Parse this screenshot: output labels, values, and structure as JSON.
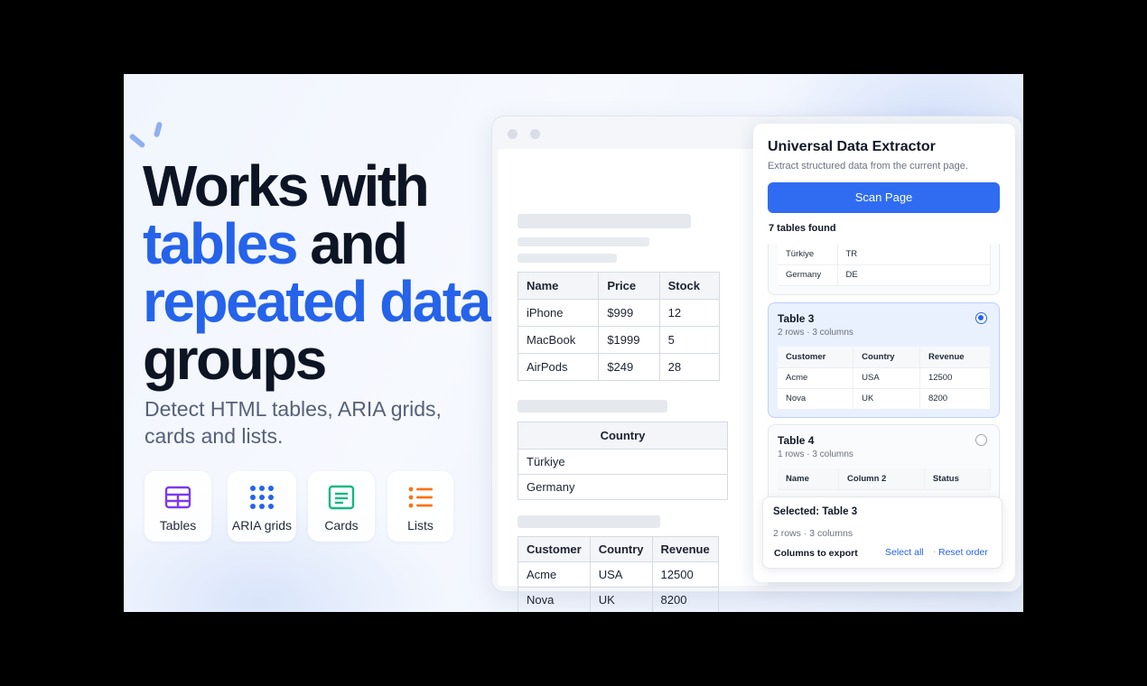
{
  "hero": {
    "line1": "Works with",
    "line2_blue": "tables",
    "line2_rest": " and",
    "line3_blue": "repeated data",
    "line4": "groups",
    "subhead": "Detect HTML tables, ARIA grids, cards and lists."
  },
  "features": [
    {
      "label": "Tables",
      "icon": "table-icon",
      "color": "#7c3aed"
    },
    {
      "label": "ARIA grids",
      "icon": "grid-dots-icon",
      "color": "#2563eb"
    },
    {
      "label": "Cards",
      "icon": "card-icon",
      "color": "#10b981"
    },
    {
      "label": "Lists",
      "icon": "list-icon",
      "color": "#f97316"
    }
  ],
  "webpage": {
    "table1": {
      "headers": [
        "Name",
        "Price",
        "Stock"
      ],
      "rows": [
        [
          "iPhone",
          "$999",
          "12"
        ],
        [
          "MacBook",
          "$1999",
          "5"
        ],
        [
          "AirPods",
          "$249",
          "28"
        ]
      ]
    },
    "table2": {
      "headers": [
        "Country"
      ],
      "rows": [
        [
          "Türkiye"
        ],
        [
          "Germany"
        ]
      ]
    },
    "table3": {
      "headers": [
        "Customer",
        "Country",
        "Revenue"
      ],
      "rows": [
        [
          "Acme",
          "USA",
          "12500"
        ],
        [
          "Nova",
          "UK",
          "8200"
        ]
      ]
    }
  },
  "panel": {
    "title": "Universal Data Extractor",
    "subtitle": "Extract structured data from the current page.",
    "scan_label": "Scan Page",
    "found_text": "7 tables found",
    "partial_card": {
      "rows": [
        [
          "Türkiye",
          "TR"
        ],
        [
          "Germany",
          "DE"
        ]
      ]
    },
    "table3_card": {
      "title": "Table 3",
      "meta": "2 rows · 3 columns",
      "selected": true,
      "headers": [
        "Customer",
        "Country",
        "Revenue"
      ],
      "rows": [
        [
          "Acme",
          "USA",
          "12500"
        ],
        [
          "Nova",
          "UK",
          "8200"
        ]
      ]
    },
    "table4_card": {
      "title": "Table 4",
      "meta": "1 rows · 3 columns",
      "selected": false,
      "headers": [
        "Name",
        "Column 2",
        "Status"
      ]
    },
    "selection": {
      "title": "Selected: Table 3",
      "meta": "2 rows · 3 columns",
      "columns_label": "Columns to export",
      "select_all": "Select all",
      "separator": "·",
      "reset_order": "Reset order"
    }
  },
  "colors": {
    "accent": "#2563eb",
    "button": "#2f6cf2",
    "heading": "#0d1424"
  }
}
